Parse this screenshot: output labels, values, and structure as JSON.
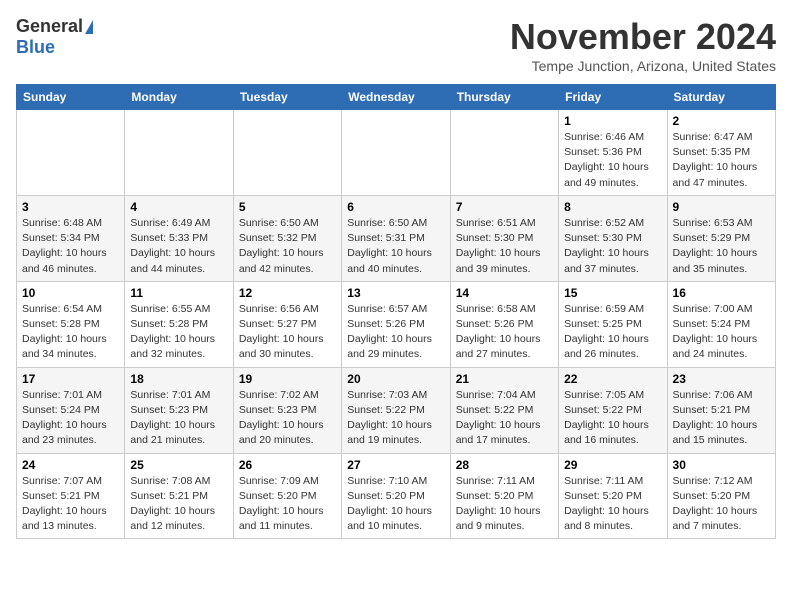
{
  "header": {
    "logo_general": "General",
    "logo_blue": "Blue",
    "month_title": "November 2024",
    "location": "Tempe Junction, Arizona, United States"
  },
  "weekdays": [
    "Sunday",
    "Monday",
    "Tuesday",
    "Wednesday",
    "Thursday",
    "Friday",
    "Saturday"
  ],
  "weeks": [
    [
      null,
      null,
      null,
      null,
      null,
      {
        "day": "1",
        "sunrise": "Sunrise: 6:46 AM",
        "sunset": "Sunset: 5:36 PM",
        "daylight": "Daylight: 10 hours and 49 minutes."
      },
      {
        "day": "2",
        "sunrise": "Sunrise: 6:47 AM",
        "sunset": "Sunset: 5:35 PM",
        "daylight": "Daylight: 10 hours and 47 minutes."
      }
    ],
    [
      {
        "day": "3",
        "sunrise": "Sunrise: 6:48 AM",
        "sunset": "Sunset: 5:34 PM",
        "daylight": "Daylight: 10 hours and 46 minutes."
      },
      {
        "day": "4",
        "sunrise": "Sunrise: 6:49 AM",
        "sunset": "Sunset: 5:33 PM",
        "daylight": "Daylight: 10 hours and 44 minutes."
      },
      {
        "day": "5",
        "sunrise": "Sunrise: 6:50 AM",
        "sunset": "Sunset: 5:32 PM",
        "daylight": "Daylight: 10 hours and 42 minutes."
      },
      {
        "day": "6",
        "sunrise": "Sunrise: 6:50 AM",
        "sunset": "Sunset: 5:31 PM",
        "daylight": "Daylight: 10 hours and 40 minutes."
      },
      {
        "day": "7",
        "sunrise": "Sunrise: 6:51 AM",
        "sunset": "Sunset: 5:30 PM",
        "daylight": "Daylight: 10 hours and 39 minutes."
      },
      {
        "day": "8",
        "sunrise": "Sunrise: 6:52 AM",
        "sunset": "Sunset: 5:30 PM",
        "daylight": "Daylight: 10 hours and 37 minutes."
      },
      {
        "day": "9",
        "sunrise": "Sunrise: 6:53 AM",
        "sunset": "Sunset: 5:29 PM",
        "daylight": "Daylight: 10 hours and 35 minutes."
      }
    ],
    [
      {
        "day": "10",
        "sunrise": "Sunrise: 6:54 AM",
        "sunset": "Sunset: 5:28 PM",
        "daylight": "Daylight: 10 hours and 34 minutes."
      },
      {
        "day": "11",
        "sunrise": "Sunrise: 6:55 AM",
        "sunset": "Sunset: 5:28 PM",
        "daylight": "Daylight: 10 hours and 32 minutes."
      },
      {
        "day": "12",
        "sunrise": "Sunrise: 6:56 AM",
        "sunset": "Sunset: 5:27 PM",
        "daylight": "Daylight: 10 hours and 30 minutes."
      },
      {
        "day": "13",
        "sunrise": "Sunrise: 6:57 AM",
        "sunset": "Sunset: 5:26 PM",
        "daylight": "Daylight: 10 hours and 29 minutes."
      },
      {
        "day": "14",
        "sunrise": "Sunrise: 6:58 AM",
        "sunset": "Sunset: 5:26 PM",
        "daylight": "Daylight: 10 hours and 27 minutes."
      },
      {
        "day": "15",
        "sunrise": "Sunrise: 6:59 AM",
        "sunset": "Sunset: 5:25 PM",
        "daylight": "Daylight: 10 hours and 26 minutes."
      },
      {
        "day": "16",
        "sunrise": "Sunrise: 7:00 AM",
        "sunset": "Sunset: 5:24 PM",
        "daylight": "Daylight: 10 hours and 24 minutes."
      }
    ],
    [
      {
        "day": "17",
        "sunrise": "Sunrise: 7:01 AM",
        "sunset": "Sunset: 5:24 PM",
        "daylight": "Daylight: 10 hours and 23 minutes."
      },
      {
        "day": "18",
        "sunrise": "Sunrise: 7:01 AM",
        "sunset": "Sunset: 5:23 PM",
        "daylight": "Daylight: 10 hours and 21 minutes."
      },
      {
        "day": "19",
        "sunrise": "Sunrise: 7:02 AM",
        "sunset": "Sunset: 5:23 PM",
        "daylight": "Daylight: 10 hours and 20 minutes."
      },
      {
        "day": "20",
        "sunrise": "Sunrise: 7:03 AM",
        "sunset": "Sunset: 5:22 PM",
        "daylight": "Daylight: 10 hours and 19 minutes."
      },
      {
        "day": "21",
        "sunrise": "Sunrise: 7:04 AM",
        "sunset": "Sunset: 5:22 PM",
        "daylight": "Daylight: 10 hours and 17 minutes."
      },
      {
        "day": "22",
        "sunrise": "Sunrise: 7:05 AM",
        "sunset": "Sunset: 5:22 PM",
        "daylight": "Daylight: 10 hours and 16 minutes."
      },
      {
        "day": "23",
        "sunrise": "Sunrise: 7:06 AM",
        "sunset": "Sunset: 5:21 PM",
        "daylight": "Daylight: 10 hours and 15 minutes."
      }
    ],
    [
      {
        "day": "24",
        "sunrise": "Sunrise: 7:07 AM",
        "sunset": "Sunset: 5:21 PM",
        "daylight": "Daylight: 10 hours and 13 minutes."
      },
      {
        "day": "25",
        "sunrise": "Sunrise: 7:08 AM",
        "sunset": "Sunset: 5:21 PM",
        "daylight": "Daylight: 10 hours and 12 minutes."
      },
      {
        "day": "26",
        "sunrise": "Sunrise: 7:09 AM",
        "sunset": "Sunset: 5:20 PM",
        "daylight": "Daylight: 10 hours and 11 minutes."
      },
      {
        "day": "27",
        "sunrise": "Sunrise: 7:10 AM",
        "sunset": "Sunset: 5:20 PM",
        "daylight": "Daylight: 10 hours and 10 minutes."
      },
      {
        "day": "28",
        "sunrise": "Sunrise: 7:11 AM",
        "sunset": "Sunset: 5:20 PM",
        "daylight": "Daylight: 10 hours and 9 minutes."
      },
      {
        "day": "29",
        "sunrise": "Sunrise: 7:11 AM",
        "sunset": "Sunset: 5:20 PM",
        "daylight": "Daylight: 10 hours and 8 minutes."
      },
      {
        "day": "30",
        "sunrise": "Sunrise: 7:12 AM",
        "sunset": "Sunset: 5:20 PM",
        "daylight": "Daylight: 10 hours and 7 minutes."
      }
    ]
  ]
}
